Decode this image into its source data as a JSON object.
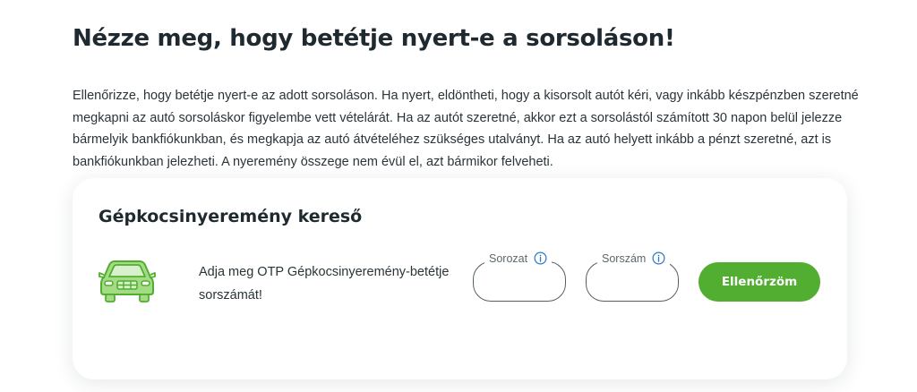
{
  "page": {
    "title": "Nézze meg, hogy betétje nyert-e a sorsoláson!",
    "intro": "Ellenőrizze, hogy betétje nyert-e az adott sorsoláson. Ha nyert, eldöntheti, hogy a kisorsolt autót kéri, vagy inkább készpénzben szeretné megkapni az autó sorsoláskor figyelembe vett vételárát. Ha az autót szeretné, akkor ezt a sorsolástól számított 30 napon belül jelezze bármelyik bankfiókunkban, és megkapja az autó átvételéhez szükséges utalványt. Ha az autó helyett inkább a pénzt szeretné, azt is bankfiókunkban jelezheti. A nyeremény összege nem évül el, azt bármikor felveheti."
  },
  "finder": {
    "title": "Gépkocsinyeremény kereső",
    "icon": "car-icon",
    "prompt": "Adja meg OTP Gépkocsinyeremény-betétje sorszámát!",
    "series_field": {
      "label": "Sorozat",
      "value": "",
      "icon": "info-icon"
    },
    "number_field": {
      "label": "Sorszám",
      "value": "",
      "icon": "info-icon"
    },
    "button_label": "Ellenőrzöm"
  },
  "colors": {
    "accent_green": "#52ae30",
    "icon_green_fill": "#a4dc86",
    "icon_green_stroke": "#52ae30",
    "info_blue": "#2a78c8",
    "text_dark": "#1f2a30"
  }
}
